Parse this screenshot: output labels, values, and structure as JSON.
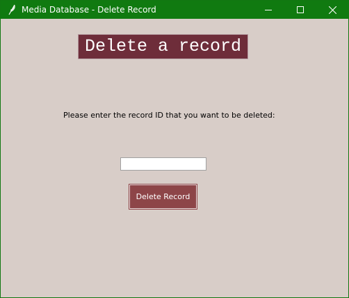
{
  "window": {
    "title": "Media Database - Delete Record",
    "icon": "feather-icon",
    "titlebar_color": "#107a10",
    "background_color": "#d8cdc8"
  },
  "window_controls": {
    "minimize_icon": "minimize-icon",
    "maximize_icon": "maximize-icon",
    "close_icon": "close-icon"
  },
  "form": {
    "heading": "Delete a record",
    "heading_color": "#6e2d3a",
    "prompt": "Please enter the record ID that you want to be deleted:",
    "record_id": {
      "value": "",
      "placeholder": ""
    },
    "delete_button_label": "Delete Record",
    "delete_button_color": "#8d4548"
  }
}
